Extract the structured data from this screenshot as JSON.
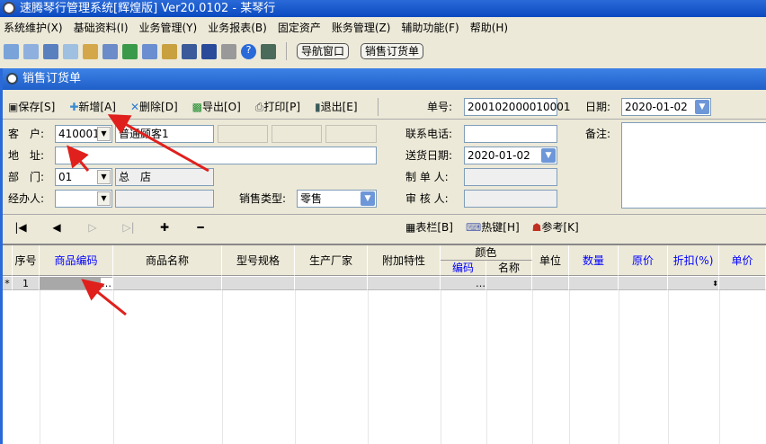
{
  "app": {
    "title": "速腾琴行管理系统[辉煌版] Ver20.0102  -  某琴行"
  },
  "menu": [
    "系统维护(X)",
    "基础资料(I)",
    "业务管理(Y)",
    "业务报表(B)",
    "固定资产",
    "账务管理(Z)",
    "辅助功能(F)",
    "帮助(H)"
  ],
  "toolbar": {
    "nav_window": "导航窗口",
    "sales_order": "销售订货单"
  },
  "window": {
    "title": "销售订货单"
  },
  "actions": {
    "save": "保存[S]",
    "add": "新增[A]",
    "delete": "删除[D]",
    "export": "导出[O]",
    "print": "打印[P]",
    "exit": "退出[E]"
  },
  "header": {
    "order_no_label": "单号:",
    "order_no": "200102000010001",
    "date_label": "日期:",
    "date": "2020-01-02"
  },
  "form": {
    "customer_label": "客　户:",
    "customer_code": "410001",
    "customer_name": "普通顾客1",
    "address_label": "地　址:",
    "address": "",
    "dept_label": "部　门:",
    "dept_code": "01",
    "dept_name": "总　店",
    "handler_label": "经办人:",
    "handler": "",
    "sales_type_label": "销售类型:",
    "sales_type": "零售",
    "phone_label": "联系电话:",
    "phone": "",
    "delivery_label": "送货日期:",
    "delivery_date": "2020-01-02",
    "maker_label": "制 单 人:",
    "maker": "",
    "auditor_label": "审 核 人:",
    "auditor": "",
    "remark_label": "备注:",
    "remark": ""
  },
  "nav": {
    "first": "|◀",
    "prev": "◀",
    "next": "▷",
    "last": "▷|",
    "add": "✚",
    "remove": "━",
    "columns": "表栏[B]",
    "hotkeys": "热键[H]",
    "reference": "参考[K]"
  },
  "grid": {
    "columns": [
      "序号",
      "商品编码",
      "商品名称",
      "型号规格",
      "生产厂家",
      "附加特性",
      "颜色",
      "单位",
      "数量",
      "原价",
      "折扣(%)",
      "单价"
    ],
    "color_sub": [
      "编码",
      "名称"
    ],
    "rows": [
      {
        "marker": "*",
        "index": "1"
      }
    ]
  },
  "colors": {
    "title_bar": "#0a4ac0",
    "accent_blue": "#0000ff",
    "arrow": "#e0201c"
  }
}
